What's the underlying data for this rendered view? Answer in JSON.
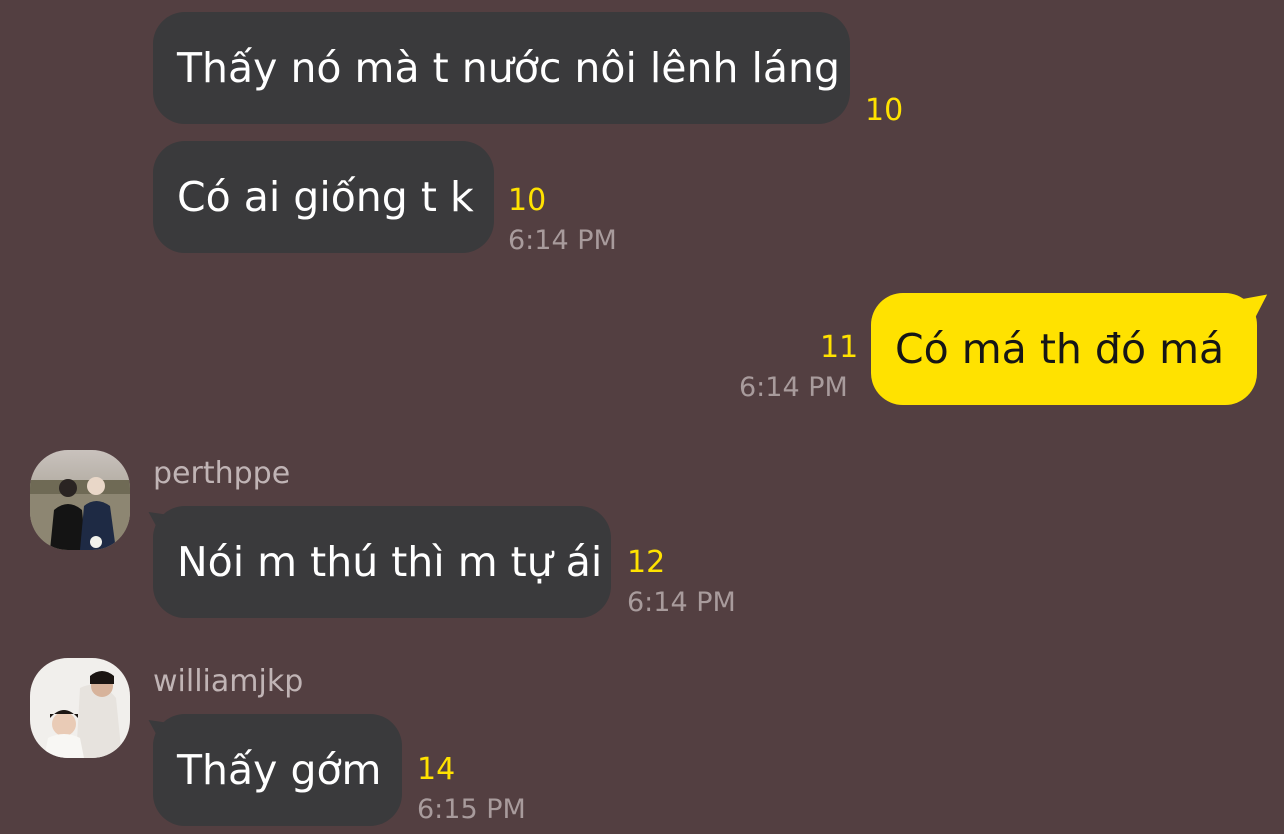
{
  "theme": {
    "background": "#533f41",
    "incoming_bubble": "#3a3a3c",
    "outgoing_bubble": "#ffe200",
    "unread_color": "#ffe200",
    "time_color": "#a89b9c",
    "sender_color": "#c0b4b5"
  },
  "messages": [
    {
      "text": "Thấy nó mà t nước nôi lênh láng",
      "unread": "10"
    },
    {
      "text": "Có ai giống t k",
      "unread": "10",
      "time": "6:14 PM"
    },
    {
      "text": "Có má th đó má",
      "unread": "11",
      "time": "6:14 PM",
      "outgoing": true
    },
    {
      "sender": "perthppe",
      "avatar_icon": "profile-photo",
      "text": "Nói m thú thì m tự ái",
      "unread": "12",
      "time": "6:14 PM"
    },
    {
      "sender": "williamjkp",
      "avatar_icon": "profile-photo",
      "text": "Thấy gớm",
      "unread": "14",
      "time": "6:15 PM"
    }
  ]
}
